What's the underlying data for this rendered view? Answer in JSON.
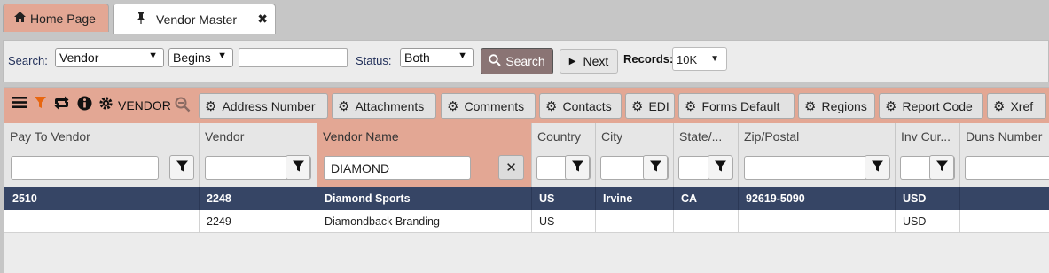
{
  "tabs": [
    {
      "label": "Home Page",
      "icon": "home-icon"
    },
    {
      "label": "Vendor Master",
      "icon": "pin-icon",
      "close_symbol": "✖"
    }
  ],
  "search": {
    "search_label": "Search:",
    "field_value": "Vendor",
    "operator_value": "Begins",
    "query_value": "",
    "status_label": "Status:",
    "status_value": "Both",
    "search_button": "Search",
    "next_button": "Next",
    "records_label": "Records:",
    "records_value": "10K"
  },
  "toolbar": {
    "title": "VENDOR",
    "buttons": [
      "Address Number",
      "Attachments",
      "Comments",
      "Contacts",
      "EDI",
      "Forms Default",
      "Regions",
      "Report Code",
      "Xref"
    ]
  },
  "grid": {
    "columns": [
      "Pay To Vendor",
      "Vendor",
      "Vendor Name",
      "Country",
      "City",
      "State/...",
      "Zip/Postal",
      "Inv Cur...",
      "Duns Number"
    ],
    "active_column": "Vendor Name",
    "filter_vendor_name": "DIAMOND",
    "clear_symbol": "✕",
    "rows": [
      [
        "2510",
        "2248",
        "Diamond Sports",
        "US",
        "Irvine",
        "CA",
        "92619-5090",
        "USD",
        ""
      ],
      [
        "",
        "2249",
        "Diamondback Branding",
        "US",
        "",
        "",
        "",
        "USD",
        ""
      ]
    ]
  },
  "colors": {
    "accent": "#e3a794",
    "selected_row": "#364565",
    "search_button": "#8a7474"
  }
}
